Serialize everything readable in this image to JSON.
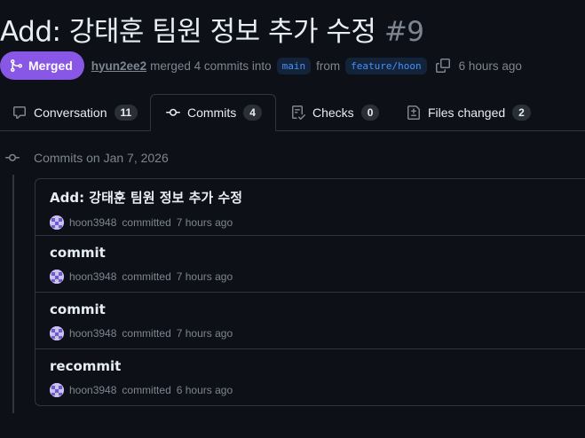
{
  "pr": {
    "title": "Add: 강태훈 팀원 정보 추가 수정",
    "number": "#9",
    "status": "Merged",
    "author": "hyun2ee2",
    "merge_text": "merged 4 commits into",
    "base_branch": "main",
    "from_text": "from",
    "head_branch": "feature/hoon",
    "time": "6 hours ago"
  },
  "tabs": [
    {
      "label": "Conversation",
      "count": "11",
      "icon": "comment-icon"
    },
    {
      "label": "Commits",
      "count": "4",
      "icon": "commit-icon",
      "selected": true
    },
    {
      "label": "Checks",
      "count": "0",
      "icon": "checklist-icon"
    },
    {
      "label": "Files changed",
      "count": "2",
      "icon": "file-diff-icon"
    }
  ],
  "timeline": {
    "date_label": "Commits on Jan 7, 2026"
  },
  "commits": [
    {
      "title": "Add: 강태훈 팀원 정보 추가 수정",
      "user": "hoon3948",
      "action": "committed",
      "time": "7 hours ago"
    },
    {
      "title": "commit",
      "user": "hoon3948",
      "action": "committed",
      "time": "7 hours ago"
    },
    {
      "title": "commit",
      "user": "hoon3948",
      "action": "committed",
      "time": "7 hours ago"
    },
    {
      "title": "recommit",
      "user": "hoon3948",
      "action": "committed",
      "time": "6 hours ago"
    }
  ],
  "colors": {
    "background": "#0d1117",
    "merged": "#8957e5",
    "branch": "#4493f8",
    "muted": "#7d8590",
    "border": "#30363d"
  }
}
